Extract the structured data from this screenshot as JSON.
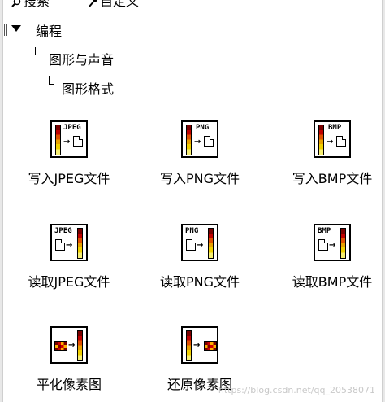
{
  "toolbar": {
    "search_label": "搜索",
    "custom_label": "自定义"
  },
  "tree": {
    "level0": "编程",
    "level1": "图形与声音",
    "level2": "图形格式"
  },
  "palette_items": [
    {
      "label": "写入JPEG文件",
      "format": "JPEG",
      "direction": "write"
    },
    {
      "label": "写入PNG文件",
      "format": "PNG",
      "direction": "write"
    },
    {
      "label": "写入BMP文件",
      "format": "BMP",
      "direction": "write"
    },
    {
      "label": "读取JPEG文件",
      "format": "JPEG",
      "direction": "read"
    },
    {
      "label": "读取PNG文件",
      "format": "PNG",
      "direction": "read"
    },
    {
      "label": "读取BMP文件",
      "format": "BMP",
      "direction": "read"
    },
    {
      "label": "平化像素图",
      "format": "",
      "direction": "flatten"
    },
    {
      "label": "还原像素图",
      "format": "",
      "direction": "unflatten"
    }
  ],
  "watermark": "https://blog.csdn.net/qq_20538071",
  "colors": {
    "meter_dark": "#7a0000",
    "meter_light": "#f6ee70"
  }
}
